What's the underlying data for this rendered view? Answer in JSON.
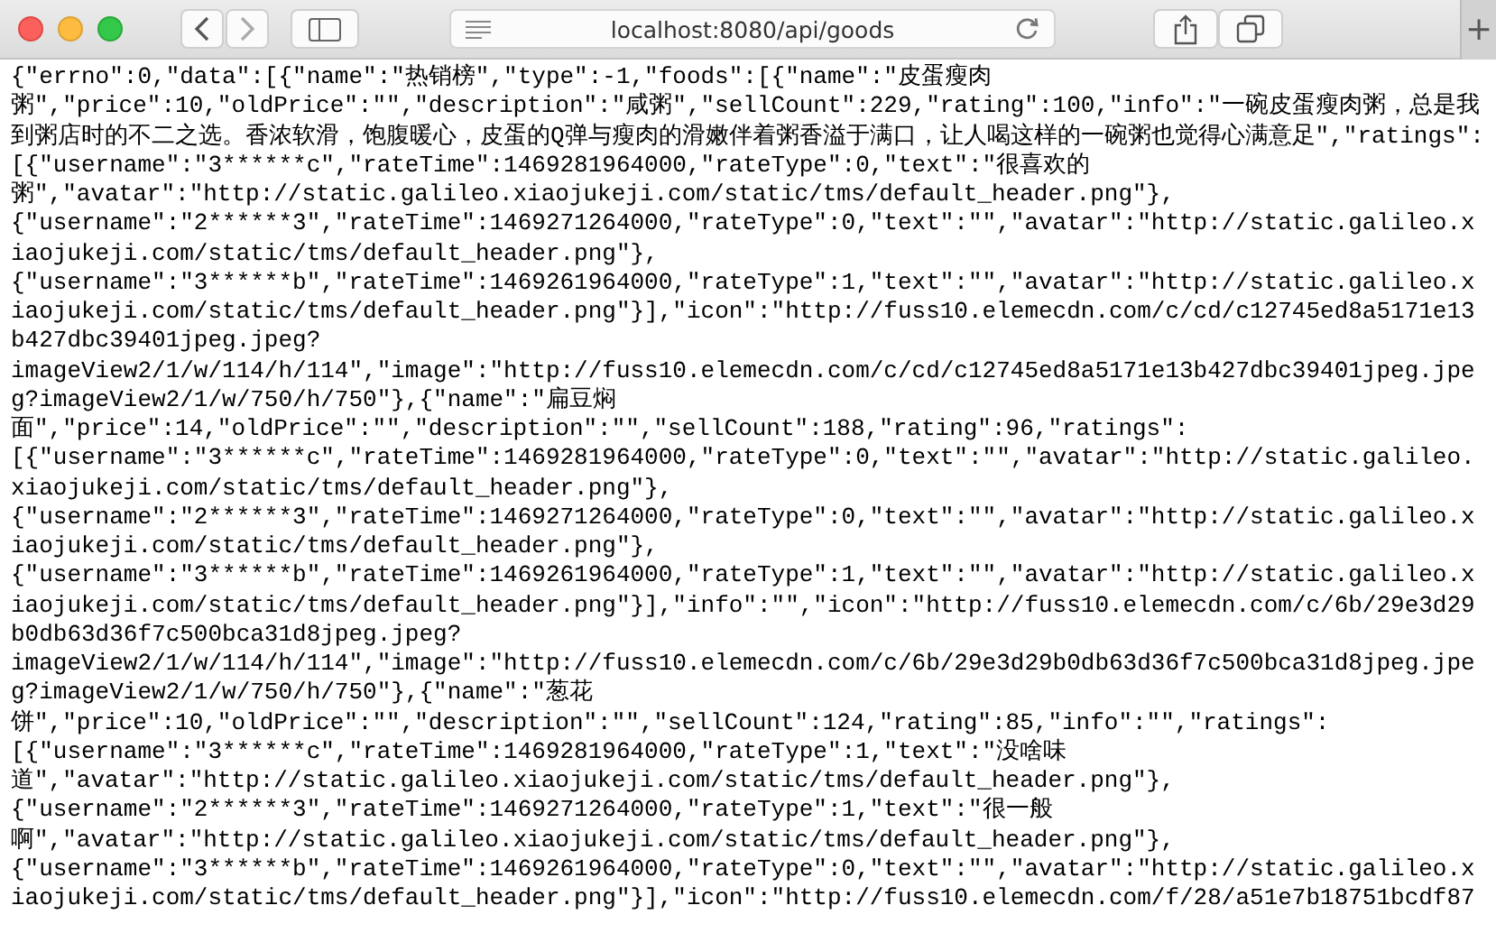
{
  "browser": {
    "address": "localhost:8080/api/goods",
    "new_tab": "+"
  },
  "body_lines": [
    "{\"errno\":0,\"data\":[{\"name\":\"热销榜\",\"type\":-1,\"foods\":[{\"name\":\"皮蛋瘦肉",
    "粥\",\"price\":10,\"oldPrice\":\"\",\"description\":\"咸粥\",\"sellCount\":229,\"rating\":100,\"info\":\"一碗皮蛋瘦肉粥，总是我",
    "到粥店时的不二之选。香浓软滑，饱腹暖心，皮蛋的Q弹与瘦肉的滑嫩伴着粥香溢于满口，让人喝这样的一碗粥也觉得心满意足\",\"ratings\":",
    "[{\"username\":\"3******c\",\"rateTime\":1469281964000,\"rateType\":0,\"text\":\"很喜欢的",
    "粥\",\"avatar\":\"http://static.galileo.xiaojukeji.com/static/tms/default_header.png\"},",
    "{\"username\":\"2******3\",\"rateTime\":1469271264000,\"rateType\":0,\"text\":\"\",\"avatar\":\"http://static.galileo.x",
    "iaojukeji.com/static/tms/default_header.png\"},",
    "{\"username\":\"3******b\",\"rateTime\":1469261964000,\"rateType\":1,\"text\":\"\",\"avatar\":\"http://static.galileo.x",
    "iaojukeji.com/static/tms/default_header.png\"}],\"icon\":\"http://fuss10.elemecdn.com/c/cd/c12745ed8a5171e13",
    "b427dbc39401jpeg.jpeg?",
    "imageView2/1/w/114/h/114\",\"image\":\"http://fuss10.elemecdn.com/c/cd/c12745ed8a5171e13b427dbc39401jpeg.jpe",
    "g?imageView2/1/w/750/h/750\"},{\"name\":\"扁豆焖",
    "面\",\"price\":14,\"oldPrice\":\"\",\"description\":\"\",\"sellCount\":188,\"rating\":96,\"ratings\":",
    "[{\"username\":\"3******c\",\"rateTime\":1469281964000,\"rateType\":0,\"text\":\"\",\"avatar\":\"http://static.galileo.",
    "xiaojukeji.com/static/tms/default_header.png\"},",
    "{\"username\":\"2******3\",\"rateTime\":1469271264000,\"rateType\":0,\"text\":\"\",\"avatar\":\"http://static.galileo.x",
    "iaojukeji.com/static/tms/default_header.png\"},",
    "{\"username\":\"3******b\",\"rateTime\":1469261964000,\"rateType\":1,\"text\":\"\",\"avatar\":\"http://static.galileo.x",
    "iaojukeji.com/static/tms/default_header.png\"}],\"info\":\"\",\"icon\":\"http://fuss10.elemecdn.com/c/6b/29e3d29",
    "b0db63d36f7c500bca31d8jpeg.jpeg?",
    "imageView2/1/w/114/h/114\",\"image\":\"http://fuss10.elemecdn.com/c/6b/29e3d29b0db63d36f7c500bca31d8jpeg.jpe",
    "g?imageView2/1/w/750/h/750\"},{\"name\":\"葱花",
    "饼\",\"price\":10,\"oldPrice\":\"\",\"description\":\"\",\"sellCount\":124,\"rating\":85,\"info\":\"\",\"ratings\":",
    "[{\"username\":\"3******c\",\"rateTime\":1469281964000,\"rateType\":1,\"text\":\"没啥味",
    "道\",\"avatar\":\"http://static.galileo.xiaojukeji.com/static/tms/default_header.png\"},",
    "{\"username\":\"2******3\",\"rateTime\":1469271264000,\"rateType\":1,\"text\":\"很一般",
    "啊\",\"avatar\":\"http://static.galileo.xiaojukeji.com/static/tms/default_header.png\"},",
    "{\"username\":\"3******b\",\"rateTime\":1469261964000,\"rateType\":0,\"text\":\"\",\"avatar\":\"http://static.galileo.x",
    "iaojukeji.com/static/tms/default_header.png\"}],\"icon\":\"http://fuss10.elemecdn.com/f/28/a51e7b18751bcdf87"
  ]
}
